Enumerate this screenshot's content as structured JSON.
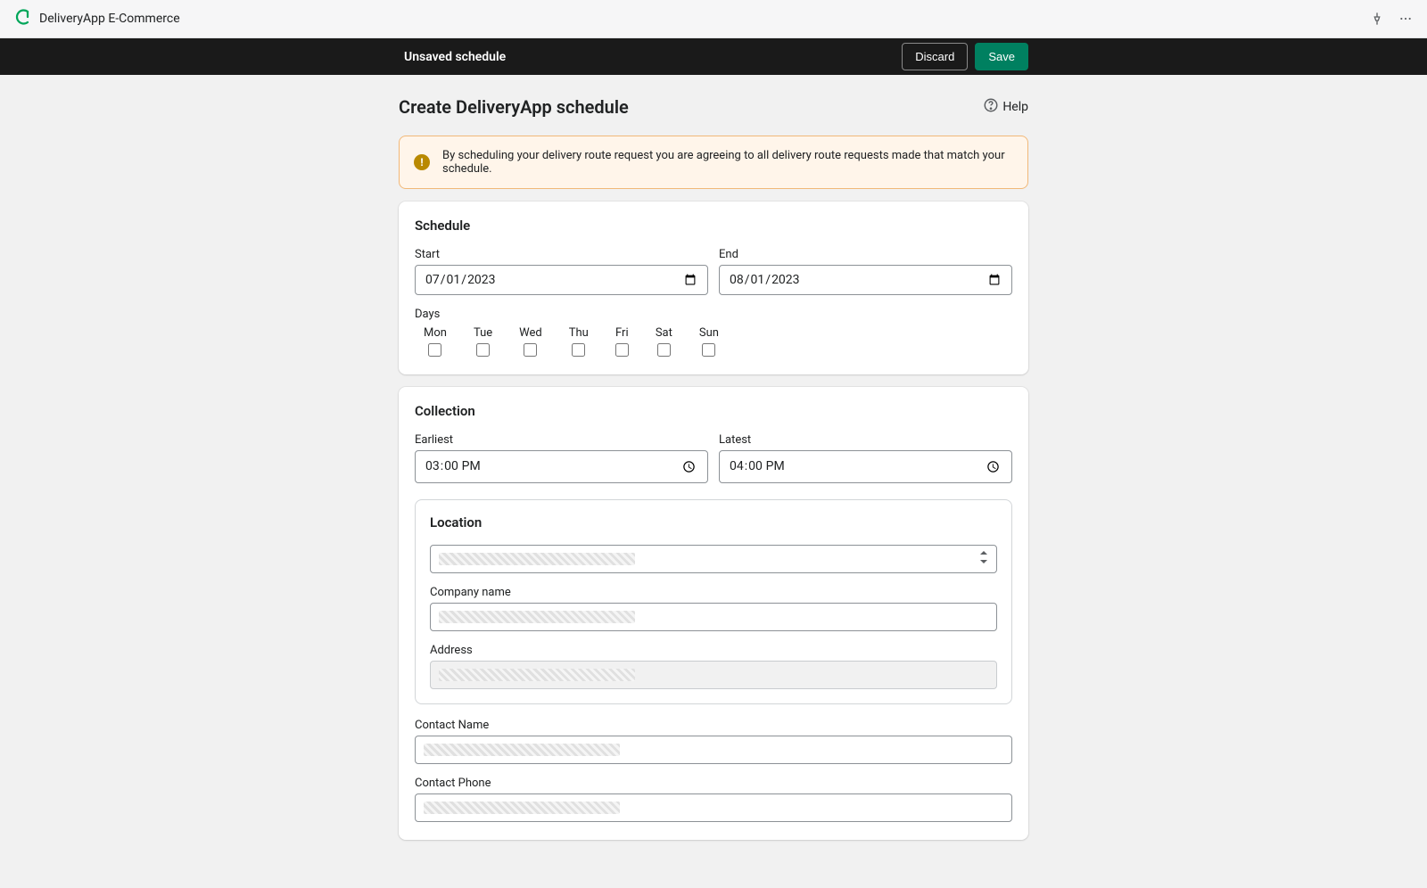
{
  "app_title": "DeliveryApp E-Commerce",
  "actionbar": {
    "title": "Unsaved schedule",
    "discard": "Discard",
    "save": "Save"
  },
  "page": {
    "title": "Create DeliveryApp schedule",
    "help": "Help"
  },
  "banner": {
    "text": "By scheduling your delivery route request you are agreeing to all delivery route requests made that match your schedule."
  },
  "schedule": {
    "title": "Schedule",
    "start_label": "Start",
    "start_value": "2023-07-01",
    "end_label": "End",
    "end_value": "2023-08-01",
    "days_label": "Days",
    "days": [
      "Mon",
      "Tue",
      "Wed",
      "Thu",
      "Fri",
      "Sat",
      "Sun"
    ]
  },
  "collection": {
    "title": "Collection",
    "earliest_label": "Earliest",
    "earliest_value": "15:00",
    "latest_label": "Latest",
    "latest_value": "16:00",
    "location_title": "Location",
    "location_select": "",
    "company_label": "Company name",
    "company_value": "",
    "address_label": "Address",
    "address_value": "",
    "contact_name_label": "Contact Name",
    "contact_name_value": "",
    "contact_phone_label": "Contact Phone",
    "contact_phone_value": ""
  }
}
